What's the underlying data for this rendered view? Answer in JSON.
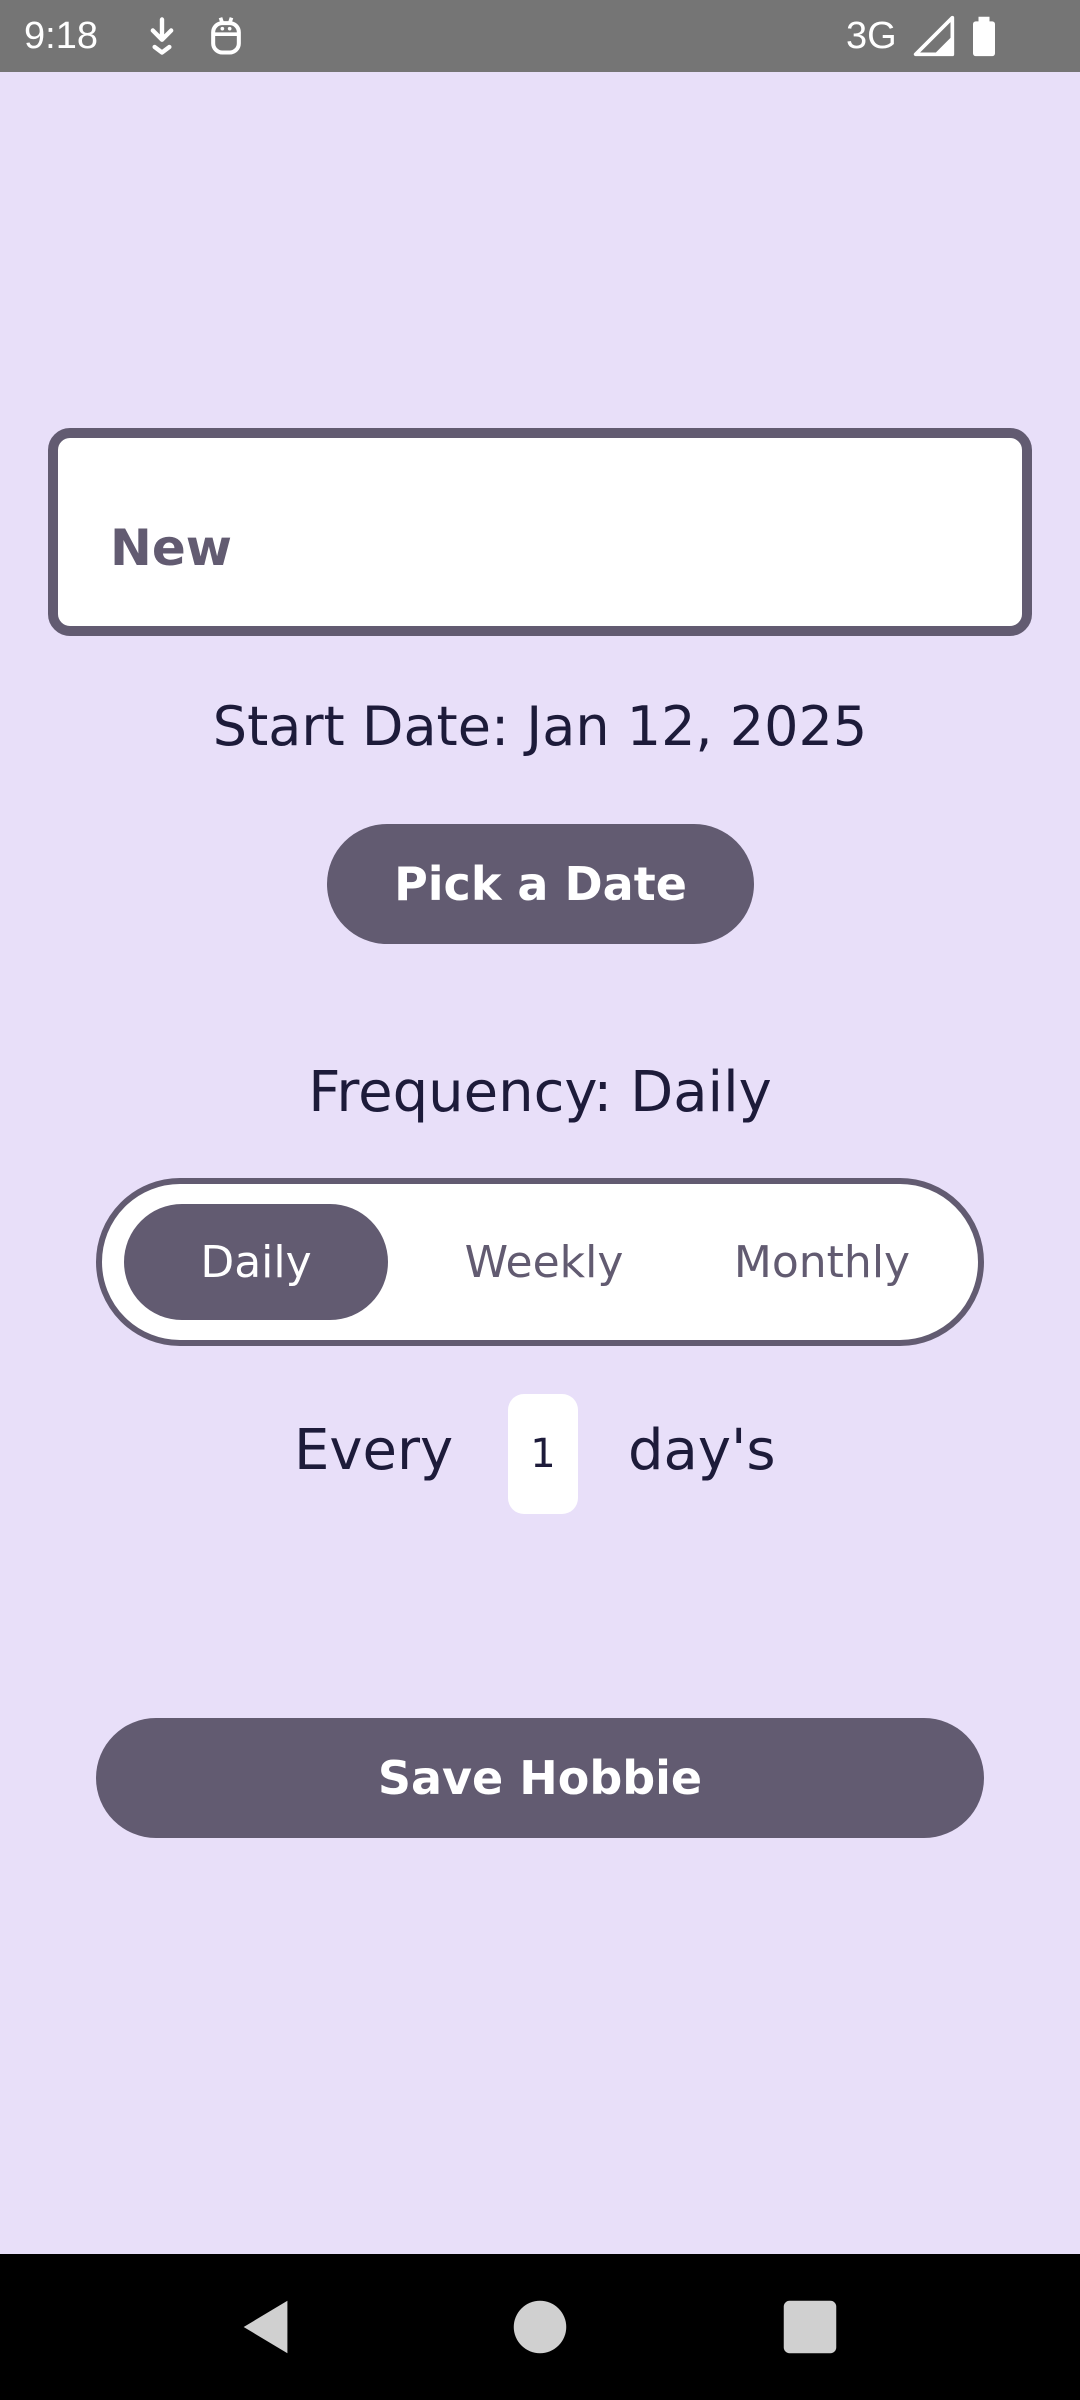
{
  "status_bar": {
    "time": "9:18",
    "network": "3G",
    "icons": [
      "download-icon",
      "android-debug-icon",
      "signal-icon",
      "battery-icon"
    ]
  },
  "form": {
    "name_value": "New",
    "start_date_text": "Start Date: Jan 12, 2025",
    "pick_date_label": "Pick a Date",
    "frequency_text": "Frequency: Daily",
    "frequency_options": [
      "Daily",
      "Weekly",
      "Monthly"
    ],
    "selected_frequency": "Daily",
    "every_label": "Every",
    "interval_value": "1",
    "unit_label": "day's",
    "save_label": "Save Hobbie"
  },
  "nav_bar": {
    "buttons": [
      "back-icon",
      "home-icon",
      "recents-icon"
    ]
  },
  "colors": {
    "background": "#e8dff9",
    "primary": "#625b71",
    "text": "#1d1b3a",
    "status_bar": "#757575"
  }
}
